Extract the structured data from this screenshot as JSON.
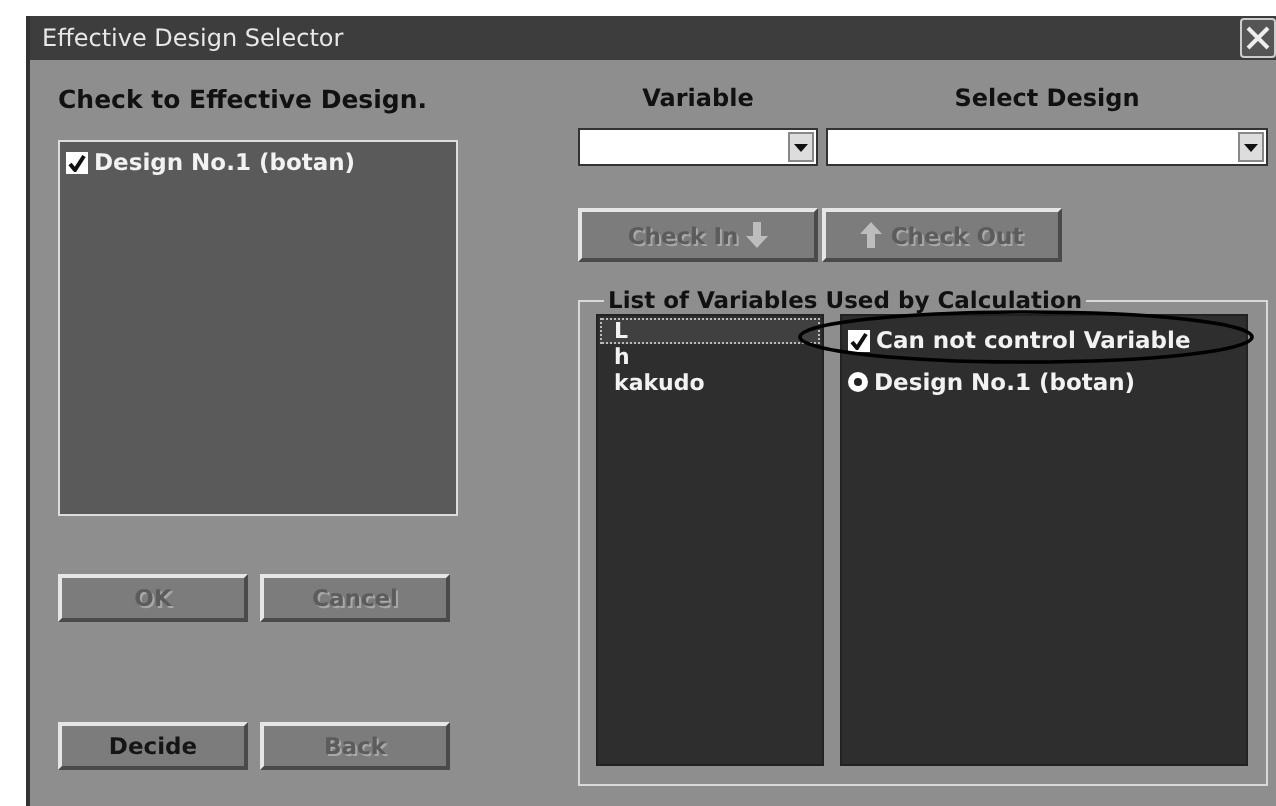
{
  "window": {
    "title": "Effective Design Selector"
  },
  "designs": {
    "heading": "Check to Effective Design.",
    "items": [
      {
        "label": "Design No.1 (botan)",
        "checked": true
      }
    ]
  },
  "left_buttons": [
    {
      "label": "OK",
      "disabled": true
    },
    {
      "label": "Cancel",
      "disabled": true
    }
  ],
  "bottom_buttons": [
    {
      "label": "Decide",
      "disabled": false
    },
    {
      "label": "Back",
      "disabled": true
    }
  ],
  "selectors": [
    {
      "label": "Variable"
    },
    {
      "label": "Select Design"
    }
  ],
  "check_buttons": [
    {
      "label": "Check In",
      "kind": "check_in",
      "disabled": true
    },
    {
      "label": "Check Out",
      "kind": "check_out",
      "disabled": true
    }
  ],
  "variables_group": {
    "legend": "List of Variables Used by Calculation",
    "variables": [
      {
        "label": "L",
        "selected": true
      },
      {
        "label": "h",
        "selected": false
      },
      {
        "label": "kakudo",
        "selected": false
      }
    ],
    "options": [
      {
        "kind": "checkbox",
        "label": "Can not control Variable",
        "checked": true
      },
      {
        "kind": "radio",
        "label": "Design No.1 (botan)",
        "selected": true
      }
    ]
  }
}
